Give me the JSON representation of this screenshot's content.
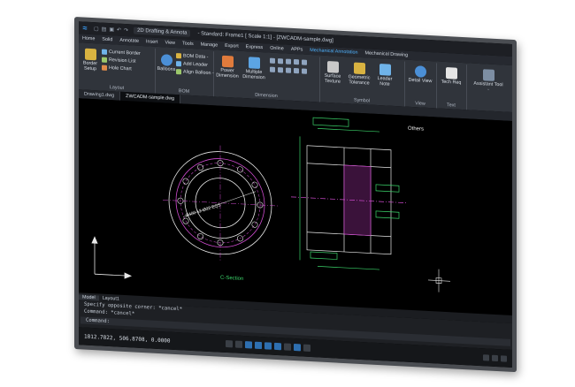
{
  "app": {
    "workspace": "2D Drafting & Annota",
    "document_title": "- Standard: Frame1 [ Scale 1:1] - [ZWCADM-sample.dwg]"
  },
  "ribbon_tabs": [
    "Home",
    "Solid",
    "Annotate",
    "Insert",
    "View",
    "Tools",
    "Manage",
    "Export",
    "Express",
    "Online",
    "APPs",
    "Mechanical Annotation",
    "Mechanical Drawing"
  ],
  "active_tab_index": 11,
  "ribbon": {
    "border_setup": "Border Setup",
    "current_border": "Current Border",
    "revision_list": "Revision List",
    "hole_chart": "Hole Chart",
    "layout_group": "Layout",
    "balloons": "Balloons",
    "bom_data": "BOM Data -",
    "add_leader": "Add Leader",
    "align_balloon": "Align Balloon -",
    "bom_group": "BOM",
    "power_dimension": "Power Dimension",
    "multiple_dimension": "Multiple Dimension",
    "dimension_group": "Dimension",
    "surface_texture": "Surface Texture",
    "geometric_tolerance": "Geometric Tolerance",
    "leader_note": "Leader Note",
    "symbol_group": "Symbol",
    "detail_view": "Detail View",
    "view_group": "View",
    "tech_req": "Tech Req",
    "text_group": "Text",
    "assistant_tool": "Assistant Tool -"
  },
  "doc_tabs": [
    "Drawing1.dwg",
    "ZWCADM-sample.dwg"
  ],
  "active_doc_tab": 1,
  "drawing": {
    "section_label": "C-Section",
    "others_label": "Others",
    "dim_label": "Ø400 12-Ø22 EQS"
  },
  "layout_tabs": [
    "Model",
    "Layout1"
  ],
  "command_lines": [
    "Specify opposite corner: *cancel*",
    "Command: *cancel*",
    "Command:"
  ],
  "status": {
    "coordinates": "1812.7822, 506.8708, 0.0000"
  },
  "colors": {
    "accent": "#4fb3ff",
    "drawing_green": "#3bd46a",
    "drawing_magenta": "#d04bd0",
    "drawing_white": "#e8e8e8"
  }
}
